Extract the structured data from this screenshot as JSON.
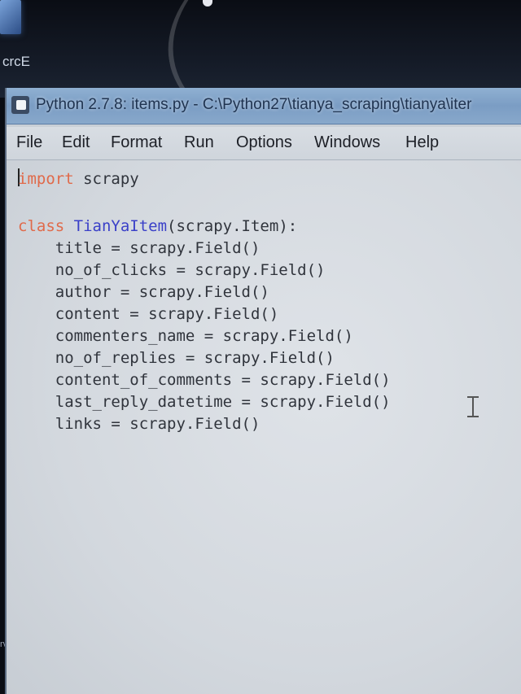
{
  "desktop": {
    "icon_label": "crcE",
    "side_label": "rv"
  },
  "window": {
    "title": "Python 2.7.8: items.py - C:\\Python27\\tianya_scraping\\tianya\\iter"
  },
  "menubar": {
    "items": [
      "File",
      "Edit",
      "Format",
      "Run",
      "Options",
      "Windows",
      "Help"
    ]
  },
  "editor": {
    "import_kw": "import",
    "import_rest": " scrapy",
    "class_kw": "class",
    "class_name": " TianYaItem",
    "class_rest": "(scrapy.Item):",
    "fields": [
      "    title = scrapy.Field()",
      "    no_of_clicks = scrapy.Field()",
      "    author = scrapy.Field()",
      "    content = scrapy.Field()",
      "    commenters_name = scrapy.Field()",
      "    no_of_replies = scrapy.Field()",
      "    content_of_comments = scrapy.Field()",
      "    last_reply_datetime = scrapy.Field()",
      "    links = scrapy.Field()"
    ]
  },
  "colors": {
    "keyword": "#e06a4a",
    "class_name": "#3a40c8",
    "code_text": "#30343c"
  }
}
